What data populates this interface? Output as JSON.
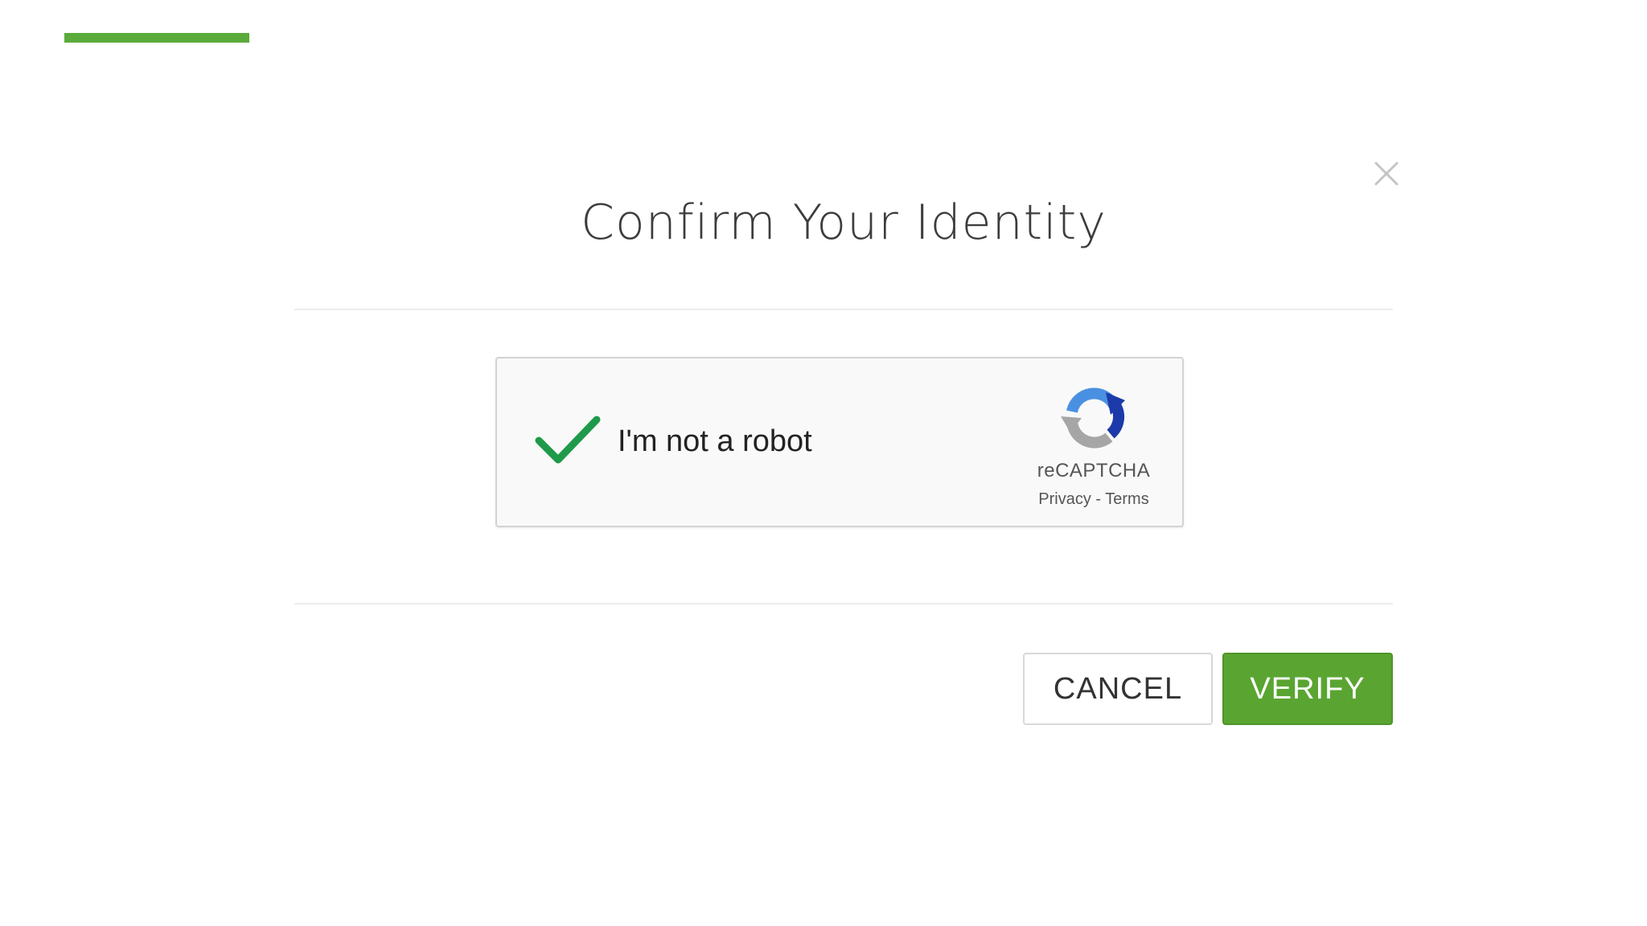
{
  "dialog": {
    "title": "Confirm Your Identity",
    "close_icon": "close-icon"
  },
  "recaptcha": {
    "checkbox_state": "checked",
    "label": "I'm not a robot",
    "brand": "reCAPTCHA",
    "privacy": "Privacy",
    "separator": " - ",
    "terms": "Terms"
  },
  "actions": {
    "cancel_label": "CANCEL",
    "verify_label": "VERIFY"
  },
  "colors": {
    "accent": "#5aab3a",
    "verify_button": "#5aa532",
    "checkmark": "#1e9a4a"
  }
}
